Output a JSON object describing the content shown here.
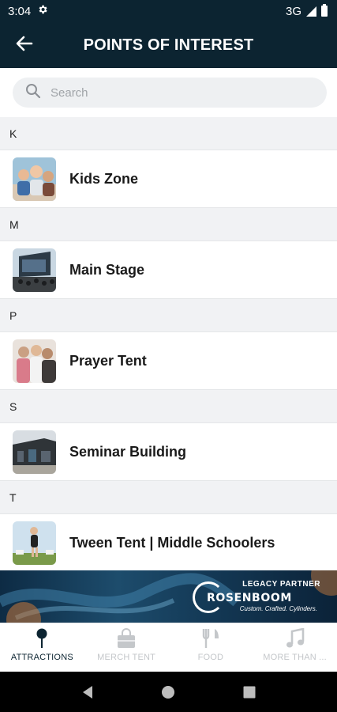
{
  "status_bar": {
    "time": "3:04",
    "network": "3G",
    "icons": [
      "gear-icon",
      "signal-icon",
      "battery-icon"
    ]
  },
  "header": {
    "title": "POINTS OF INTEREST",
    "back_icon": "arrow-left-icon"
  },
  "search": {
    "placeholder": "Search",
    "value": ""
  },
  "sections": [
    {
      "letter": "K",
      "items": [
        {
          "label": "Kids Zone",
          "thumbnail": "kids-zone-photo"
        }
      ]
    },
    {
      "letter": "M",
      "items": [
        {
          "label": "Main Stage",
          "thumbnail": "main-stage-photo"
        }
      ]
    },
    {
      "letter": "P",
      "items": [
        {
          "label": "Prayer Tent",
          "thumbnail": "prayer-tent-photo"
        }
      ]
    },
    {
      "letter": "S",
      "items": [
        {
          "label": "Seminar Building",
          "thumbnail": "seminar-building-photo"
        }
      ]
    },
    {
      "letter": "T",
      "items": [
        {
          "label": "Tween Tent | Middle Schoolers",
          "thumbnail": "tween-tent-photo"
        }
      ]
    }
  ],
  "ad": {
    "partner_label": "LEGACY PARTNER",
    "brand": "ROSENBOOM",
    "tagline": "Custom. Crafted. Cylinders."
  },
  "bottom_nav": {
    "tabs": [
      {
        "label": "ATTRACTIONS",
        "icon": "map-pin-icon",
        "active": true
      },
      {
        "label": "MERCH TENT",
        "icon": "shopping-bag-icon",
        "active": false
      },
      {
        "label": "FOOD",
        "icon": "fork-knife-icon",
        "active": false
      },
      {
        "label": "MORE THAN ...",
        "icon": "music-note-icon",
        "active": false
      }
    ]
  },
  "colors": {
    "header_bg": "#0c2431",
    "section_bg": "#f1f2f4",
    "nav_inactive": "#c4c7ca",
    "nav_active": "#0c2431"
  }
}
